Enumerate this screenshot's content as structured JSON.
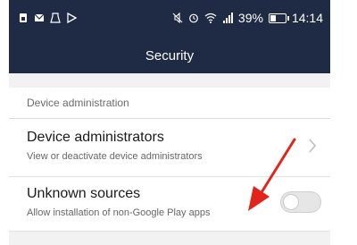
{
  "status_bar": {
    "battery_percent": "39%",
    "time": "14:14",
    "left_icons": [
      "sim-card-icon",
      "mail-icon",
      "usb-debug-icon",
      "play-store-icon"
    ],
    "right_icons": [
      "mute-icon",
      "alarm-icon",
      "wifi-icon",
      "signal-icon"
    ],
    "battery_level": 0.39
  },
  "title_bar": {
    "title": "Security"
  },
  "section": {
    "header": "Device administration"
  },
  "rows": [
    {
      "title": "Device administrators",
      "subtitle": "View or deactivate device administrators",
      "accessory": "chevron-right-icon"
    },
    {
      "title": "Unknown sources",
      "subtitle": "Allow installation of non-Google Play apps",
      "accessory": "toggle",
      "toggle_on": false
    }
  ],
  "colors": {
    "header_bg": "#1f2a44",
    "annotation_arrow": "#e1251b"
  }
}
